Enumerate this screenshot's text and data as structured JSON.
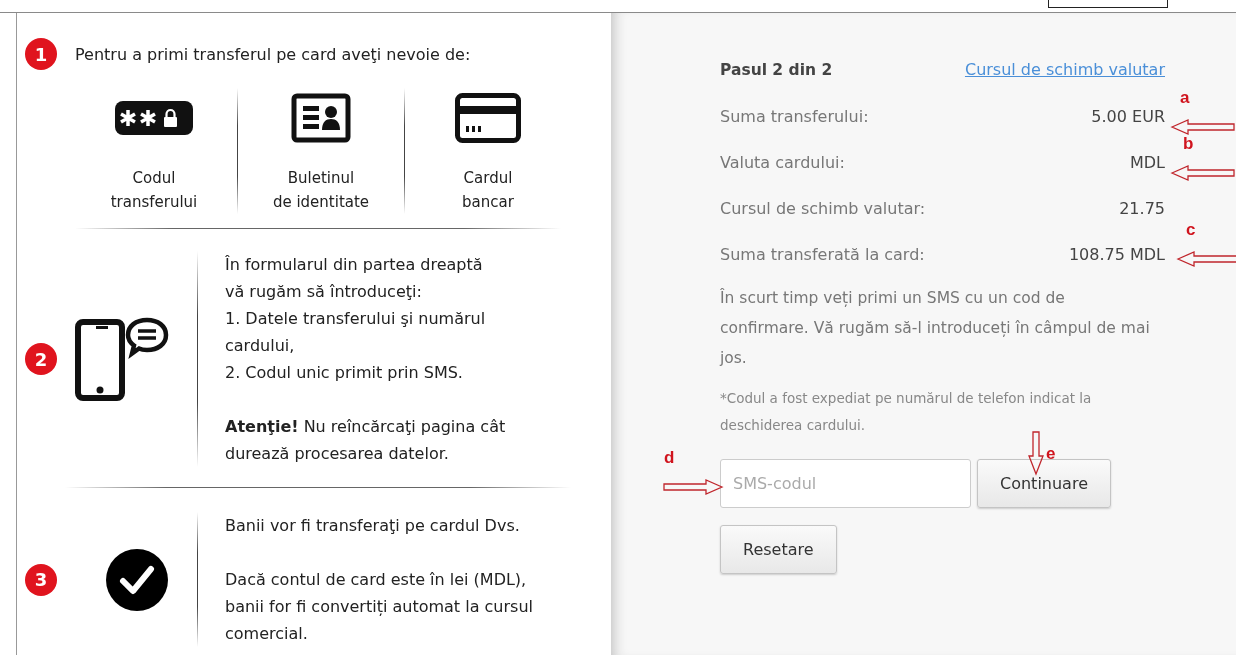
{
  "left_panel": {
    "steps": [
      {
        "number": "1",
        "kind": "requirements",
        "title": "Pentru a primi transferul pe card aveţi nevoie de:",
        "items": [
          {
            "kind": "code",
            "label": "Codul\ntransferului"
          },
          {
            "kind": "id",
            "label": "Buletinul\nde identitate"
          },
          {
            "kind": "card",
            "label": "Cardul\nbancar"
          }
        ]
      },
      {
        "number": "2",
        "kind": "phone",
        "paragraphs": [
          "În formularul din partea dreaptă\nvă rugăm să întroduceţi:\n1.  Datele transferului şi numărul\ncardului,\n2.  Codul unic primit prin SMS.",
          "**Atenţie!** Nu reîncărcaţi pagina cât\ndurează procesarea datelor."
        ]
      },
      {
        "number": "3",
        "kind": "check",
        "paragraphs": [
          "Banii vor fi transferaţi pe cardul Dvs.",
          "Dacă contul de card este în lei (MDL),\nbanii for fi convertiți automat la cursul\ncomercial."
        ]
      }
    ]
  },
  "right_panel": {
    "step": "Pasul 2 din 2",
    "link": "Cursul de schimb valutar",
    "rows": [
      {
        "label": "Suma transferului:",
        "value": "5.00 EUR"
      },
      {
        "label": "Valuta cardului:",
        "value": "MDL"
      },
      {
        "label": "Cursul de schimb valutar:",
        "value": "21.75"
      },
      {
        "label": "Suma transferată la card:",
        "value": "108.75 MDL"
      }
    ],
    "message": "În scurt timp veți primi un SMS cu un cod de confirmare. Vă rugăm să-l introduceți în câmpul de mai jos.",
    "note": "*Codul a fost expediat pe numărul de telefon indicat la deschiderea cardului.",
    "sms_field": {
      "placeholder": "SMS-codul"
    },
    "buttons": [
      "Continuare",
      "Resetare"
    ]
  },
  "annotations": [
    {
      "label": "a",
      "kind": "left"
    },
    {
      "label": "b",
      "kind": "left"
    },
    {
      "label": "c",
      "kind": "left"
    },
    {
      "label": "d",
      "kind": "right"
    },
    {
      "label": "e",
      "kind": "down"
    }
  ]
}
